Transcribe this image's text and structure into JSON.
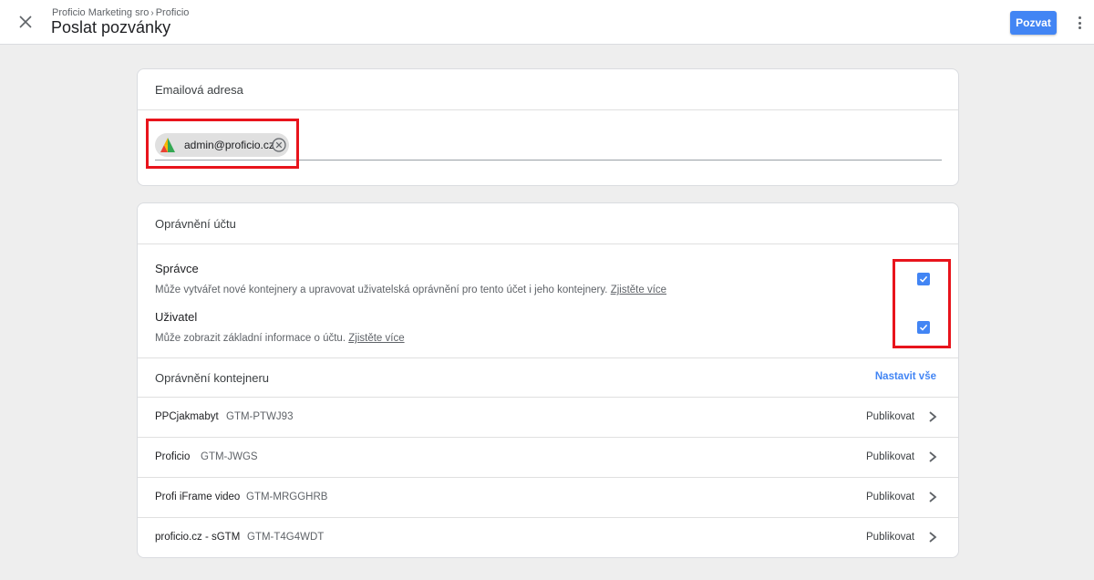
{
  "header": {
    "breadcrumb": [
      "Proficio Marketing sro",
      "Proficio"
    ],
    "breadcrumb_separator": "›",
    "title": "Poslat pozvánky",
    "invite_label": "Pozvat",
    "close_icon": "close-icon",
    "more_icon": "more-vertical-icon"
  },
  "email_card": {
    "title": "Emailová adresa",
    "chip": {
      "email": "admin@proficio.cz",
      "avatar": "proficio-logo",
      "remove_icon": "close-circle-icon"
    }
  },
  "account_permissions": {
    "title": "Oprávnění účtu",
    "roles": [
      {
        "title": "Správce",
        "description": "Může vytvářet nové kontejnery a upravovat uživatelská oprávnění pro tento účet i jeho kontejnery.",
        "link": "Zjistěte více",
        "checked": true
      },
      {
        "title": "Uživatel",
        "description": "Může zobrazit základní informace o účtu.",
        "link": "Zjistěte více",
        "checked": true
      }
    ]
  },
  "container_permissions": {
    "title": "Oprávnění kontejneru",
    "set_all_label": "Nastavit vše",
    "rows": [
      {
        "name": "PPCjakmabyt",
        "id": "GTM-PTWJ93",
        "permission": "Publikovat"
      },
      {
        "name": "Proficio",
        "id": "GTM-JWGS",
        "permission": "Publikovat"
      },
      {
        "name": "Profi iFrame video",
        "id": "GTM-MRGGHRB",
        "permission": "Publikovat"
      },
      {
        "name": "proficio.cz - sGTM",
        "id": "GTM-T4G4WDT",
        "permission": "Publikovat"
      }
    ]
  },
  "colors": {
    "accent": "#4285f4",
    "highlight": "#e8141c",
    "background": "#eeeeee"
  }
}
